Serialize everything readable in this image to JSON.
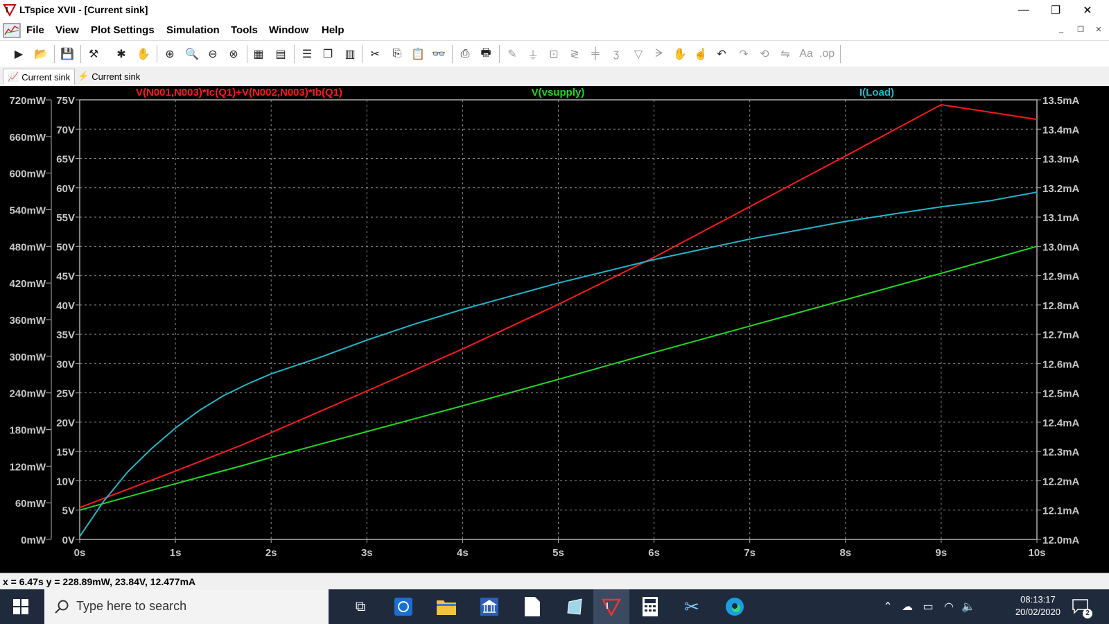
{
  "window": {
    "title": "LTspice XVII - [Current sink]",
    "minimize": "—",
    "restore": "❐",
    "close": "✕"
  },
  "menu": {
    "items": [
      "File",
      "View",
      "Plot Settings",
      "Simulation",
      "Tools",
      "Window",
      "Help"
    ],
    "mdi_minimize": "_",
    "mdi_restore": "❐",
    "mdi_close": "✕"
  },
  "toolbar": {
    "icons": [
      "run-icon",
      "open-icon",
      "save-icon",
      "control-panel-icon",
      "halt-icon",
      "pan-icon",
      "zoom-in-icon",
      "zoom-area-icon",
      "zoom-out-icon",
      "zoom-cancel-icon",
      "autoscale-icon",
      "zoom-fit-icon",
      "tile-horizontal-icon",
      "cascade-icon",
      "tile-vertical-icon",
      "cut-icon",
      "copy-icon",
      "paste-icon",
      "find-icon",
      "print-preview-icon",
      "print-icon",
      "wire-icon",
      "ground-icon",
      "label-icon",
      "resistor-icon",
      "capacitor-icon",
      "inductor-icon",
      "diode-icon",
      "component-icon",
      "move-icon",
      "drag-icon",
      "undo-icon",
      "redo-icon",
      "rotate-icon",
      "mirror-icon",
      "text-icon",
      "spice-directive-icon"
    ]
  },
  "tabs": [
    {
      "label": "Current sink",
      "icon": "waveform-icon",
      "active": true
    },
    {
      "label": "Current sink",
      "icon": "schematic-icon",
      "active": false
    }
  ],
  "chart_data": {
    "type": "line",
    "x_ticks": [
      "0s",
      "1s",
      "2s",
      "3s",
      "4s",
      "5s",
      "6s",
      "7s",
      "8s",
      "9s",
      "10s"
    ],
    "xlim": [
      0,
      10
    ],
    "y_axes": {
      "power": {
        "ticks": [
          "0mW",
          "60mW",
          "120mW",
          "180mW",
          "240mW",
          "300mW",
          "360mW",
          "420mW",
          "480mW",
          "540mW",
          "600mW",
          "660mW",
          "720mW"
        ],
        "ylim": [
          0,
          720
        ],
        "unit": "mW"
      },
      "voltage": {
        "ticks": [
          "0V",
          "5V",
          "10V",
          "15V",
          "20V",
          "25V",
          "30V",
          "35V",
          "40V",
          "45V",
          "50V",
          "55V",
          "60V",
          "65V",
          "70V",
          "75V"
        ],
        "ylim": [
          0,
          75
        ],
        "unit": "V"
      },
      "current": {
        "ticks": [
          "12.0mA",
          "12.1mA",
          "12.2mA",
          "12.3mA",
          "12.4mA",
          "12.5mA",
          "12.6mA",
          "12.7mA",
          "12.8mA",
          "12.9mA",
          "13.0mA",
          "13.1mA",
          "13.2mA",
          "13.3mA",
          "13.4mA",
          "13.5mA"
        ],
        "ylim": [
          12.0,
          13.5
        ],
        "unit": "mA"
      }
    },
    "series": [
      {
        "name": "V(N001,N003)*Ic(Q1)+V(N002,N003)*Ib(Q1)",
        "axis": "power",
        "color": "#ff1a1a",
        "x": [
          0,
          1,
          1.7,
          2,
          3,
          4,
          5,
          6,
          7,
          8,
          9,
          10
        ],
        "y": [
          52,
          112,
          155,
          175,
          243,
          312,
          385,
          462,
          545,
          628,
          712,
          688
        ]
      },
      {
        "name": "V(vsupply)",
        "axis": "voltage",
        "color": "#22d822",
        "x": [
          0,
          1,
          1.7,
          2,
          3,
          4,
          5,
          6,
          7,
          8,
          9,
          10
        ],
        "y": [
          5,
          9.5,
          12.6,
          14,
          18.4,
          22.8,
          27.3,
          31.9,
          36.4,
          40.9,
          45.4,
          50
        ]
      },
      {
        "name": "I(Load)",
        "axis": "current",
        "color": "#21b6c9",
        "x": [
          0,
          0.25,
          0.5,
          0.75,
          1,
          1.25,
          1.5,
          1.75,
          2,
          2.5,
          3,
          3.5,
          4,
          4.5,
          5,
          5.5,
          6,
          6.5,
          7,
          7.5,
          8,
          8.5,
          9,
          9.5,
          10
        ],
        "y": [
          12.01,
          12.13,
          12.23,
          12.31,
          12.38,
          12.44,
          12.49,
          12.53,
          12.565,
          12.62,
          12.68,
          12.735,
          12.785,
          12.83,
          12.875,
          12.915,
          12.955,
          12.99,
          13.025,
          13.055,
          13.085,
          13.11,
          13.135,
          13.155,
          13.185
        ]
      }
    ],
    "grid": true,
    "background": "#000000",
    "legend": "top"
  },
  "status": {
    "cursor": "x = 6.47s   y = 228.89mW, 23.84V, 12.477mA"
  },
  "taskbar": {
    "search_placeholder": "Type here to search",
    "time": "08:13:17",
    "date": "20/02/2020",
    "notifications": "2"
  }
}
